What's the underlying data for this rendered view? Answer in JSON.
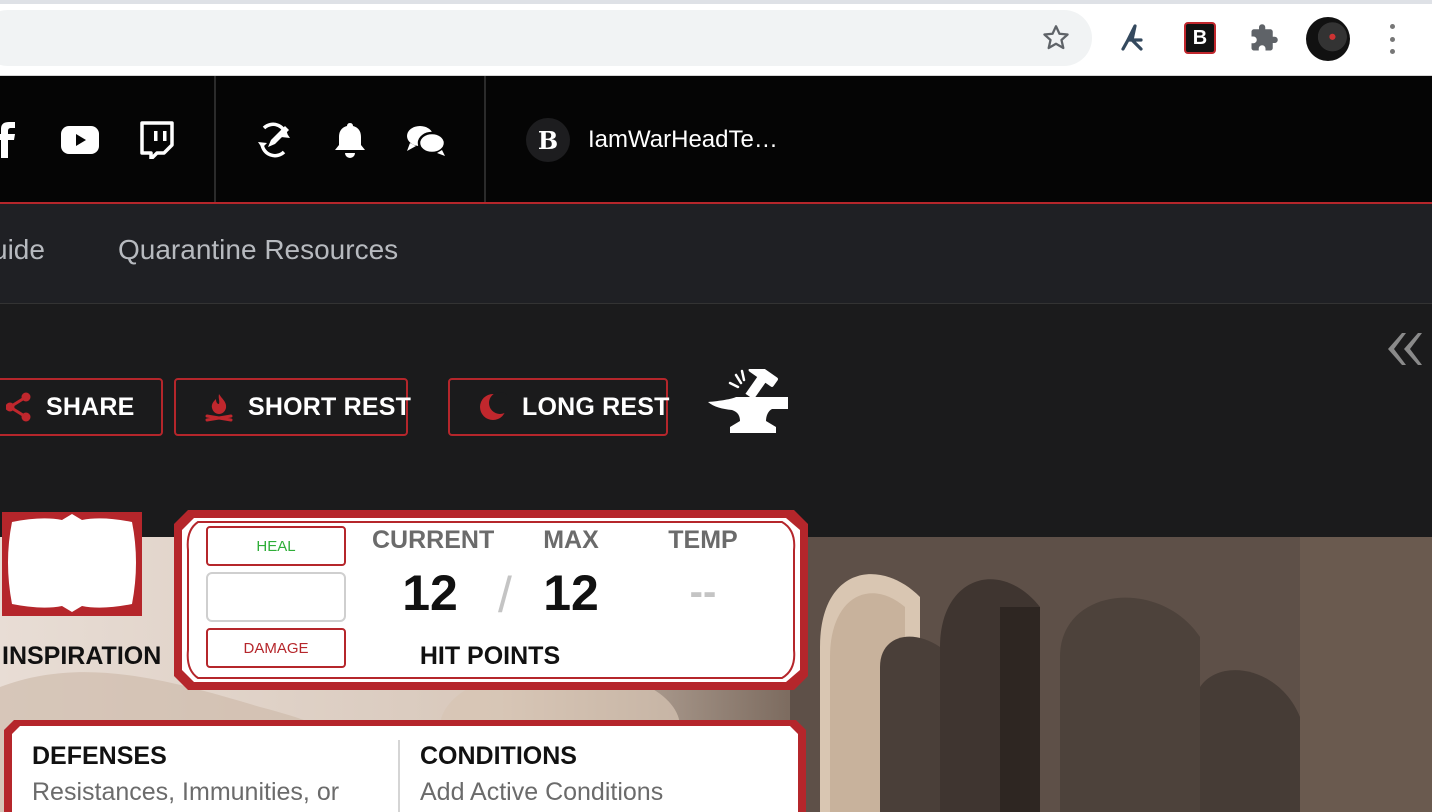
{
  "browser": {
    "bookmark_icon": "star-icon",
    "extensions": [
      "tool-extension-icon",
      "b-extension-icon",
      "puzzle-extensions-icon"
    ],
    "extension_b_letter": "B",
    "menu_icon": "kebab-menu-icon"
  },
  "topbar": {
    "social_icons": [
      "facebook-icon",
      "youtube-icon",
      "twitch-icon"
    ],
    "user_icons": [
      "edit-sync-icon",
      "bell-icon",
      "chat-icon"
    ],
    "logo_letter": "B",
    "username": "IamWarHeadTe…"
  },
  "subnav": {
    "items": [
      "uide",
      "Quarantine Resources"
    ]
  },
  "actions": {
    "share_label": "SHARE",
    "short_rest_label": "SHORT REST",
    "long_rest_label": "LONG REST"
  },
  "inspiration": {
    "label": "INSPIRATION"
  },
  "hit_points": {
    "heal_label": "HEAL",
    "damage_label": "DAMAGE",
    "current_label": "CURRENT",
    "max_label": "MAX",
    "temp_label": "TEMP",
    "current_value": "12",
    "separator": "/",
    "max_value": "12",
    "temp_value": "--",
    "title": "HIT POINTS"
  },
  "defenses": {
    "title": "DEFENSES",
    "text": "Resistances, Immunities, or"
  },
  "conditions": {
    "title": "CONDITIONS",
    "text": "Add Active Conditions"
  },
  "colors": {
    "accent_red": "#b5262b",
    "heal_green": "#2fae38",
    "topbar_bg": "#050505",
    "panel_bg": "#1b1b1c"
  }
}
